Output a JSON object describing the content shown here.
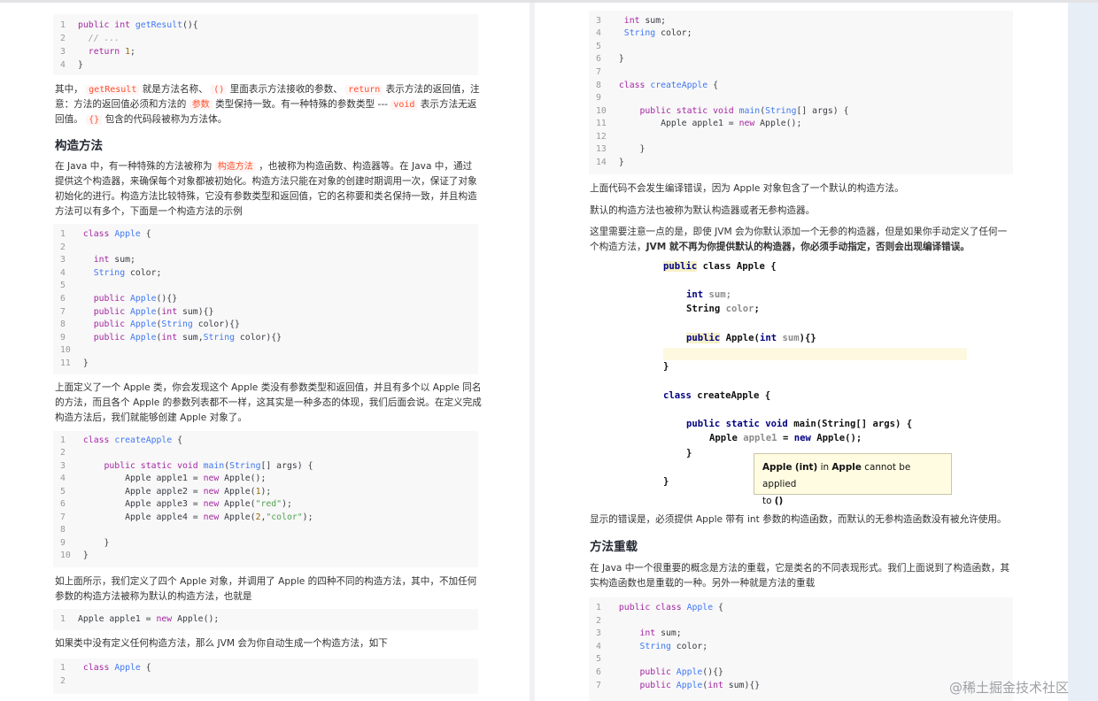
{
  "left": {
    "code1": [
      "public int getResult(){",
      "  // ...",
      "  return 1;",
      "}"
    ],
    "para1": {
      "t1": "其中，",
      "c1": "getResult",
      "t2": "就是方法名称、",
      "c2": "()",
      "t3": "里面表示方法接收的参数、",
      "c3": "return",
      "t4": "表示方法的返回值，注",
      "t5": "意：方法的返回值必须和方法的",
      "c4": "参数",
      "t6": "类型保持一致。有一种特殊的参数类型 ---",
      "c5": "void",
      "t7": "表示方法无返",
      "t8": "回值。",
      "c6": "{}",
      "t9": "包含的代码段被称为方法体。"
    },
    "heading1": "构造方法",
    "para2": {
      "t1": "在 Java 中，有一种特殊的方法被称为",
      "c1": "构造方法",
      "t2": "，也被称为构造函数、构造器等。在 Java 中，通过",
      "l2": "提供这个构造器，来确保每个对象都被初始化。构造方法只能在对象的创建时期调用一次，保证了对象",
      "l3": "初始化的进行。构造方法比较特殊，它没有参数类型和返回值，它的名称要和类名保持一致，并且构造",
      "l4": "方法可以有多个，下面是一个构造方法的示例"
    },
    "code2": [
      "class Apple {",
      "",
      "  int sum;",
      "  String color;",
      "",
      "  public Apple(){}",
      "  public Apple(int sum){}",
      "  public Apple(String color){}",
      "  public Apple(int sum,String color){}",
      "",
      "}"
    ],
    "para3": [
      "上面定义了一个 Apple 类，你会发现这个 Apple 类没有参数类型和返回值，并且有多个以 Apple 同名",
      "的方法，而且各个 Apple 的参数列表都不一样，这其实是一种多态的体现，我们后面会说。在定义完成",
      "构造方法后，我们就能够创建 Apple 对象了。"
    ],
    "code3": [
      "class createApple {",
      "",
      "    public static void main(String[] args) {",
      "        Apple apple1 = new Apple();",
      "        Apple apple2 = new Apple(1);",
      "        Apple apple3 = new Apple(\"red\");",
      "        Apple apple4 = new Apple(2,\"color\");",
      "",
      "    }",
      "}"
    ],
    "para4": [
      "如上面所示，我们定义了四个 Apple 对象，并调用了 Apple 的四种不同的构造方法，其中，不加任何",
      "参数的构造方法被称为默认的构造方法，也就是"
    ],
    "code4": [
      "Apple apple1 = new Apple();"
    ],
    "para5": "如果类中没有定义任何构造方法，那么 JVM 会为你自动生成一个构造方法，如下",
    "code5": [
      "class Apple {",
      ""
    ]
  },
  "right": {
    "code6_lines": [
      "  int sum;",
      "  String color;",
      "",
      "}",
      "",
      "class createApple {",
      "",
      "    public static void main(String[] args) {",
      "        Apple apple1 = new Apple();",
      "",
      "    }",
      "}"
    ],
    "code6_start": 3,
    "para6": "上面代码不会发生编译错误，因为 Apple 对象包含了一个默认的构造方法。",
    "para7": "默认的构造方法也被称为默认构造器或者无参构造器。",
    "para8": {
      "l1": "这里需要注意一点的是，即使 JVM 会为你默认添加一个无参的构造器，但是如果你手动定义了任何一",
      "l2a": "个构造方法，",
      "l2b": "JVM 就不再为你提供默认的构造器，你必须手动指定，否则会出现编译错误。"
    },
    "ide": {
      "l1a": "public",
      "l1b": " class Apple {",
      "l2a": "int",
      "l2b": " sum;",
      "l3a": "String ",
      "l3b": "color",
      "l4a": "public",
      "l4b": " Apple(",
      "l4c": "int",
      "l4d": " sum",
      "l5": "}",
      "l6a": "class",
      "l6b": " createApple {",
      "l7a": "public static void",
      "l7b": " main(String[] args) {",
      "l8a": "Apple ",
      "l8b": "apple1",
      "l8c": " = ",
      "l8d": "new",
      "l8e": " Apple();",
      "l9": "}",
      "l10": "}"
    },
    "tooltip": {
      "a": "Apple",
      "b": "(int)",
      "c": "in",
      "d": "Apple",
      "e": "cannot be applied",
      "f": "to",
      "g": "()"
    },
    "para9": "显示的错误是，必须提供 Apple 带有 int 参数的构造函数，而默认的无参构造函数没有被允许使用。",
    "heading2": "方法重载",
    "para10": [
      "在 Java 中一个很重要的概念是方法的重载，它是类名的不同表现形式。我们上面说到了构造函数，其",
      "实构造函数也是重载的一种。另外一种就是方法的重载"
    ],
    "code7": [
      "public class Apple {",
      "",
      "    int sum;",
      "    String color;",
      "",
      "    public Apple(){}",
      "    public Apple(int sum){}"
    ]
  },
  "watermark": "@稀土掘金技术社区"
}
